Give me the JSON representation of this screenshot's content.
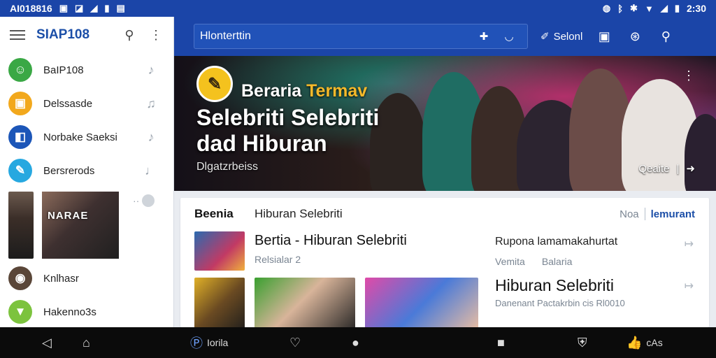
{
  "status_bar": {
    "carrier": "AI018816",
    "time": "2:30",
    "left_icons": [
      "notification-icon",
      "image-icon",
      "signal-icon",
      "battery-icon",
      "sim-icon"
    ],
    "right_icons": [
      "nfc-icon",
      "bluetooth-icon",
      "bluetooth-alt-icon",
      "wifi-icon",
      "cell-signal-icon",
      "battery-icon"
    ]
  },
  "sidebar": {
    "app_title": "SIAP108",
    "contacts": [
      {
        "name": "BaIP108",
        "color": "#3aa845",
        "glyph": "☺",
        "trail": "♪"
      },
      {
        "name": "Delssasde",
        "color": "#f2a81c",
        "glyph": "▣",
        "trail": "♫"
      },
      {
        "name": "Norbake Saeksi",
        "color": "#1c56b8",
        "glyph": "◧",
        "trail": "♪"
      },
      {
        "name": "Bersrerods",
        "color": "#27a8e0",
        "glyph": "✎",
        "trail": "♩"
      }
    ],
    "photo_label": "NARAE",
    "more_contacts": [
      {
        "name": "Knlhasr",
        "color": "#5a4638",
        "glyph": "◉"
      },
      {
        "name": "Hakenno3s",
        "color": "#7cc33e",
        "glyph": "▼"
      }
    ]
  },
  "top_bar": {
    "search_value": "Hlonterttin",
    "selected_label": "Selonl"
  },
  "hero": {
    "kicker_white": "Beraria",
    "kicker_accent": "Termav",
    "title": "Selebriti Selebriti dad Hiburan",
    "subtitle": "Dlgatzrbeiss",
    "cta": "Qeaite"
  },
  "card": {
    "label": "Beenia",
    "title": "Hiburan Selebriti",
    "tab_inactive": "Noa",
    "tab_active": "lemurant",
    "article1": {
      "title": "Bertia - Hiburan Selebriti",
      "meta": "Relsialar 2"
    },
    "article2": {
      "title": "Rupona lamamakahurtat",
      "meta1": "Vemita",
      "meta2": "Balaria"
    },
    "article3": {
      "title": "Hiburan Selebriti",
      "meta": "Danenant Pactakrbin cis Rl0010"
    }
  },
  "nav_bar": {
    "profile_label": "Iorila",
    "right_label": "cAs"
  },
  "colors": {
    "primary": "#1b45a8",
    "accent": "#1c4fa8",
    "hero_accent": "#f5b92a"
  }
}
